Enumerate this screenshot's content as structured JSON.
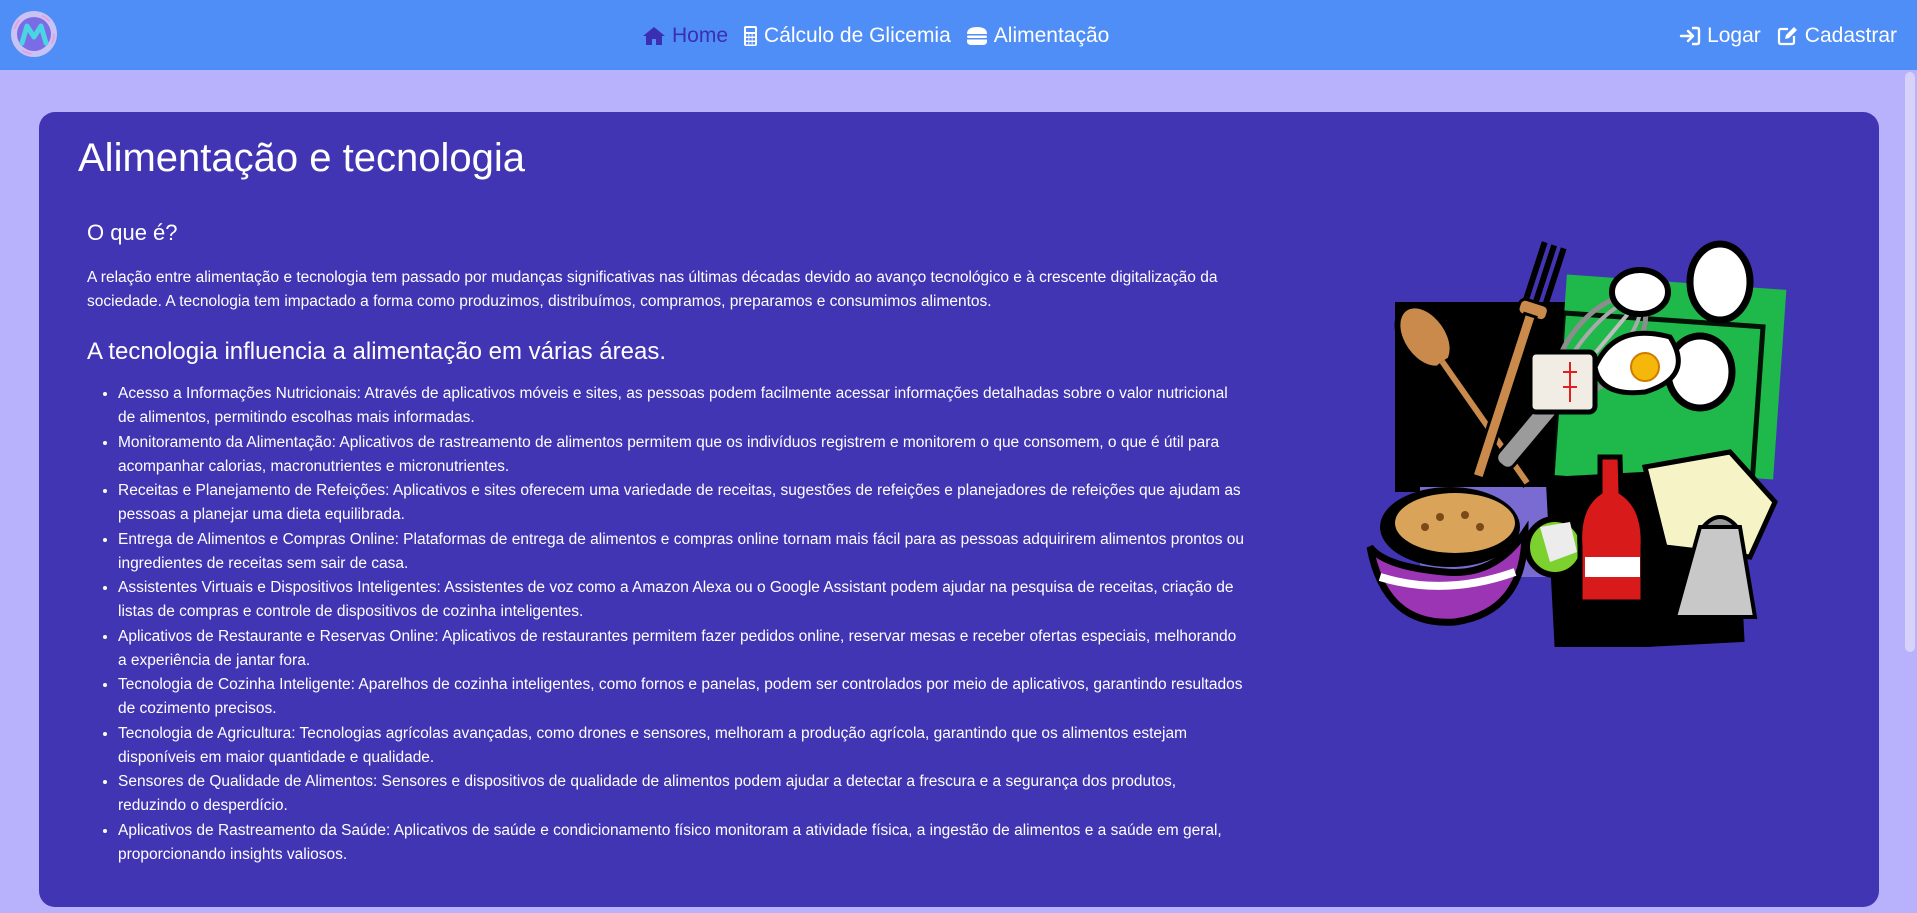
{
  "header": {
    "nav_links": [
      {
        "label": "Home",
        "icon": "home-icon",
        "active": true
      },
      {
        "label": "Cálculo de Glicemia",
        "icon": "calculator-icon"
      },
      {
        "label": "Alimentação",
        "icon": "burger-icon"
      }
    ],
    "auth_links": [
      {
        "label": "Logar",
        "icon": "login-icon"
      },
      {
        "label": "Cadastrar",
        "icon": "edit-icon"
      }
    ]
  },
  "main": {
    "title": "Alimentação e tecnologia",
    "section1": {
      "heading": "O que é?",
      "paragraph": "A relação entre alimentação e tecnologia tem passado por mudanças significativas nas últimas décadas devido ao avanço tecnológico e à crescente digitalização da sociedade. A tecnologia tem impactado a forma como produzimos, distribuímos, compramos, preparamos e consumimos alimentos."
    },
    "section2": {
      "heading": "A tecnologia influencia a alimentação em várias áreas.",
      "items": [
        "Acesso a Informações Nutricionais: Através de aplicativos móveis e sites, as pessoas podem facilmente acessar informações detalhadas sobre o valor nutricional de alimentos, permitindo escolhas mais informadas.",
        "Monitoramento da Alimentação: Aplicativos de rastreamento de alimentos permitem que os indivíduos registrem e monitorem o que consomem, o que é útil para acompanhar calorias, macronutrientes e micronutrientes.",
        "Receitas e Planejamento de Refeições: Aplicativos e sites oferecem uma variedade de receitas, sugestões de refeições e planejadores de refeições que ajudam as pessoas a planejar uma dieta equilibrada.",
        "Entrega de Alimentos e Compras Online: Plataformas de entrega de alimentos e compras online tornam mais fácil para as pessoas adquirirem alimentos prontos ou ingredientes de receitas sem sair de casa.",
        "Assistentes Virtuais e Dispositivos Inteligentes: Assistentes de voz como a Amazon Alexa ou o Google Assistant podem ajudar na pesquisa de receitas, criação de listas de compras e controle de dispositivos de cozinha inteligentes.",
        "Aplicativos de Restaurante e Reservas Online: Aplicativos de restaurantes permitem fazer pedidos online, reservar mesas e receber ofertas especiais, melhorando a experiência de jantar fora.",
        "Tecnologia de Cozinha Inteligente: Aparelhos de cozinha inteligentes, como fornos e panelas, podem ser controlados por meio de aplicativos, garantindo resultados de cozimento precisos.",
        "Tecnologia de Agricultura: Tecnologias agrícolas avançadas, como drones e sensores, melhoram a produção agrícola, garantindo que os alimentos estejam disponíveis em maior quantidade e qualidade.",
        "Sensores de Qualidade de Alimentos: Sensores e dispositivos de qualidade de alimentos podem ajudar a detectar a frescura e a segurança dos produtos, reduzindo o desperdício.",
        "Aplicativos de Rastreamento da Saúde: Aplicativos de saúde e condicionamento físico monitoram a atividade física, a ingestão de alimentos e a saúde em geral, proporcionando insights valiosos."
      ]
    }
  },
  "colors": {
    "navbar": "#4f8ef7",
    "page_bg": "#b8b1fb",
    "card_bg": "#4235b4",
    "active_link": "#3a2fb3"
  }
}
